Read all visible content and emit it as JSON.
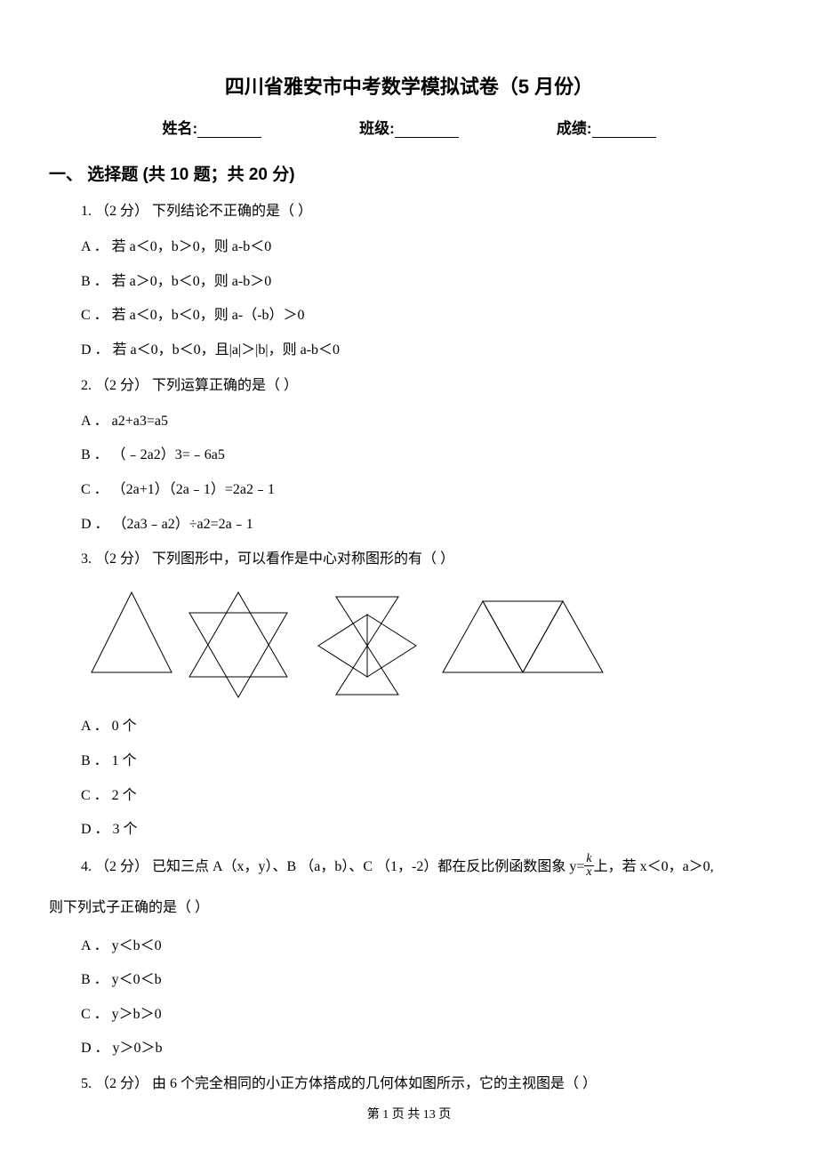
{
  "title": "四川省雅安市中考数学模拟试卷（5 月份）",
  "header": {
    "name_label": "姓名:",
    "class_label": "班级:",
    "score_label": "成绩:"
  },
  "section1": "一、 选择题 (共 10 题；共 20 分)",
  "q1": {
    "stem": "1. （2 分） 下列结论不正确的是（    ）",
    "A": "A ． 若 a＜0，b＞0，则 a-b＜0",
    "B": "B ． 若 a＞0，b＜0，则 a-b＞0",
    "C": "C ． 若 a＜0，b＜0，则 a-（-b）＞0",
    "D": "D ． 若 a＜0，b＜0，且|a|＞|b|，则 a-b＜0"
  },
  "q2": {
    "stem": "2. （2 分） 下列运算正确的是（    ）",
    "A": "A ． a2+a3=a5",
    "B": "B ． （﹣2a2）3=﹣6a5",
    "C": "C ． （2a+1）（2a﹣1）=2a2﹣1",
    "D": "D ． （2a3﹣a2）÷a2=2a﹣1"
  },
  "q3": {
    "stem": "3. （2 分） 下列图形中，可以看作是中心对称图形的有（    ）",
    "A": "A ． 0 个",
    "B": "B ． 1 个",
    "C": "C ． 2 个",
    "D": "D ． 3 个"
  },
  "q4": {
    "line1_pre": "4. （2 分） 已知三点 A（x，y）、B  （a，b）、C  （1，-2）都在反比例函数图象 y=",
    "line1_post": "上，若 x＜0，a＞0,",
    "line2": "则下列式子正确的是（    ）",
    "A": "A ． y＜b＜0",
    "B": "B ． y＜0＜b",
    "C": "C ． y＞b＞0",
    "D": "D ． y＞0＞b"
  },
  "q5": {
    "stem": "5. （2 分） 由 6 个完全相同的小正方体搭成的几何体如图所示，它的主视图是（    ）"
  },
  "footer": "第 1 页 共 13 页",
  "frac": {
    "num": "k",
    "den": "x"
  }
}
